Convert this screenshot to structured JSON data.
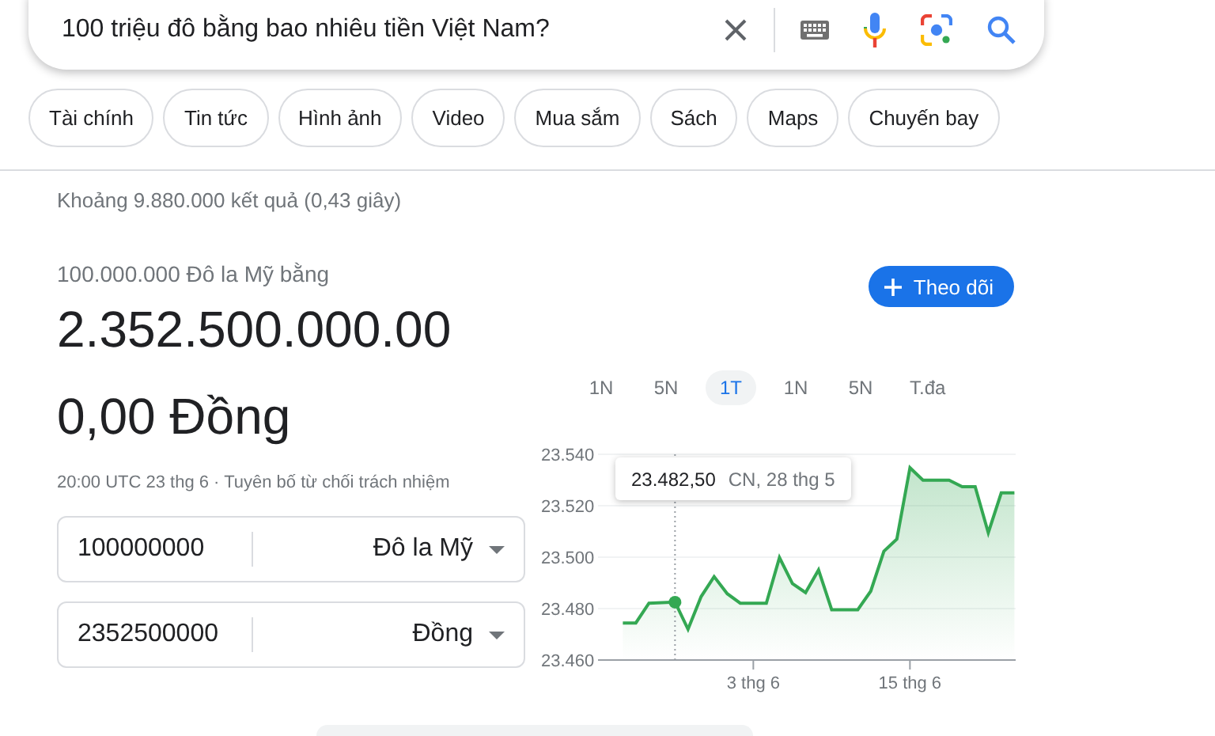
{
  "search": {
    "query": "100 triệu đô bằng bao nhiêu tiền Việt Nam?"
  },
  "chips": [
    {
      "label": "Tài chính"
    },
    {
      "label": "Tin tức"
    },
    {
      "label": "Hình ảnh"
    },
    {
      "label": "Video"
    },
    {
      "label": "Mua sắm"
    },
    {
      "label": "Sách"
    },
    {
      "label": "Maps"
    },
    {
      "label": "Chuyến bay"
    }
  ],
  "result_stats": "Khoảng 9.880.000 kết quả (0,43 giây)",
  "converter": {
    "from_line": "100.000.000 Đô la Mỹ bằng",
    "result_lines": [
      "2.352.500.000.00",
      "0,00 Đồng"
    ],
    "timestamp": "20:00 UTC 23 thg 6 · Tuyên bố từ chối trách nhiệm",
    "fields": [
      {
        "value": "100000000",
        "currency": "Đô la Mỹ"
      },
      {
        "value": "2352500000",
        "currency": "Đồng"
      }
    ]
  },
  "follow_button": "Theo dõi",
  "periods": [
    {
      "label": "1N",
      "selected": false
    },
    {
      "label": "5N",
      "selected": false
    },
    {
      "label": "1T",
      "selected": true
    },
    {
      "label": "1N",
      "selected": false
    },
    {
      "label": "5N",
      "selected": false
    },
    {
      "label": "T.đa",
      "selected": false
    }
  ],
  "chart": {
    "tooltip": {
      "value": "23.482,50",
      "date": "CN, 28 thg 5"
    },
    "chart_data": {
      "type": "area",
      "categories": [
        null,
        null,
        null,
        null,
        null,
        null,
        null,
        null,
        null,
        null,
        "3 thg 6",
        null,
        null,
        null,
        null,
        null,
        null,
        null,
        null,
        null,
        null,
        null,
        "15 thg 6",
        null,
        null,
        null,
        null,
        null,
        null,
        null,
        null
      ],
      "series": [
        {
          "color": "#34a853",
          "values": [
            23474.4,
            23474.4,
            23482.1,
            null,
            23482.5,
            23472,
            23484.7,
            23492.4,
            23485.8,
            23482.1,
            null,
            23482.1,
            23499.8,
            23489.7,
            23486.2,
            23495,
            23479.6,
            null,
            23479.6,
            23486.8,
            23502.3,
            23507,
            23534.8,
            23529.9,
            null,
            23529.9,
            23527.4,
            23527.4,
            23509.5,
            23525,
            23525
          ]
        }
      ],
      "grid": true,
      "ylim": [
        23460,
        23540
      ],
      "yticks": [
        {
          "value": 23460,
          "label": "23.460"
        },
        {
          "value": 23480,
          "label": "23.480"
        },
        {
          "value": 23500,
          "label": "23.500"
        },
        {
          "value": 23520,
          "label": "23.520"
        },
        {
          "value": 23540,
          "label": "23.540"
        }
      ]
    }
  }
}
